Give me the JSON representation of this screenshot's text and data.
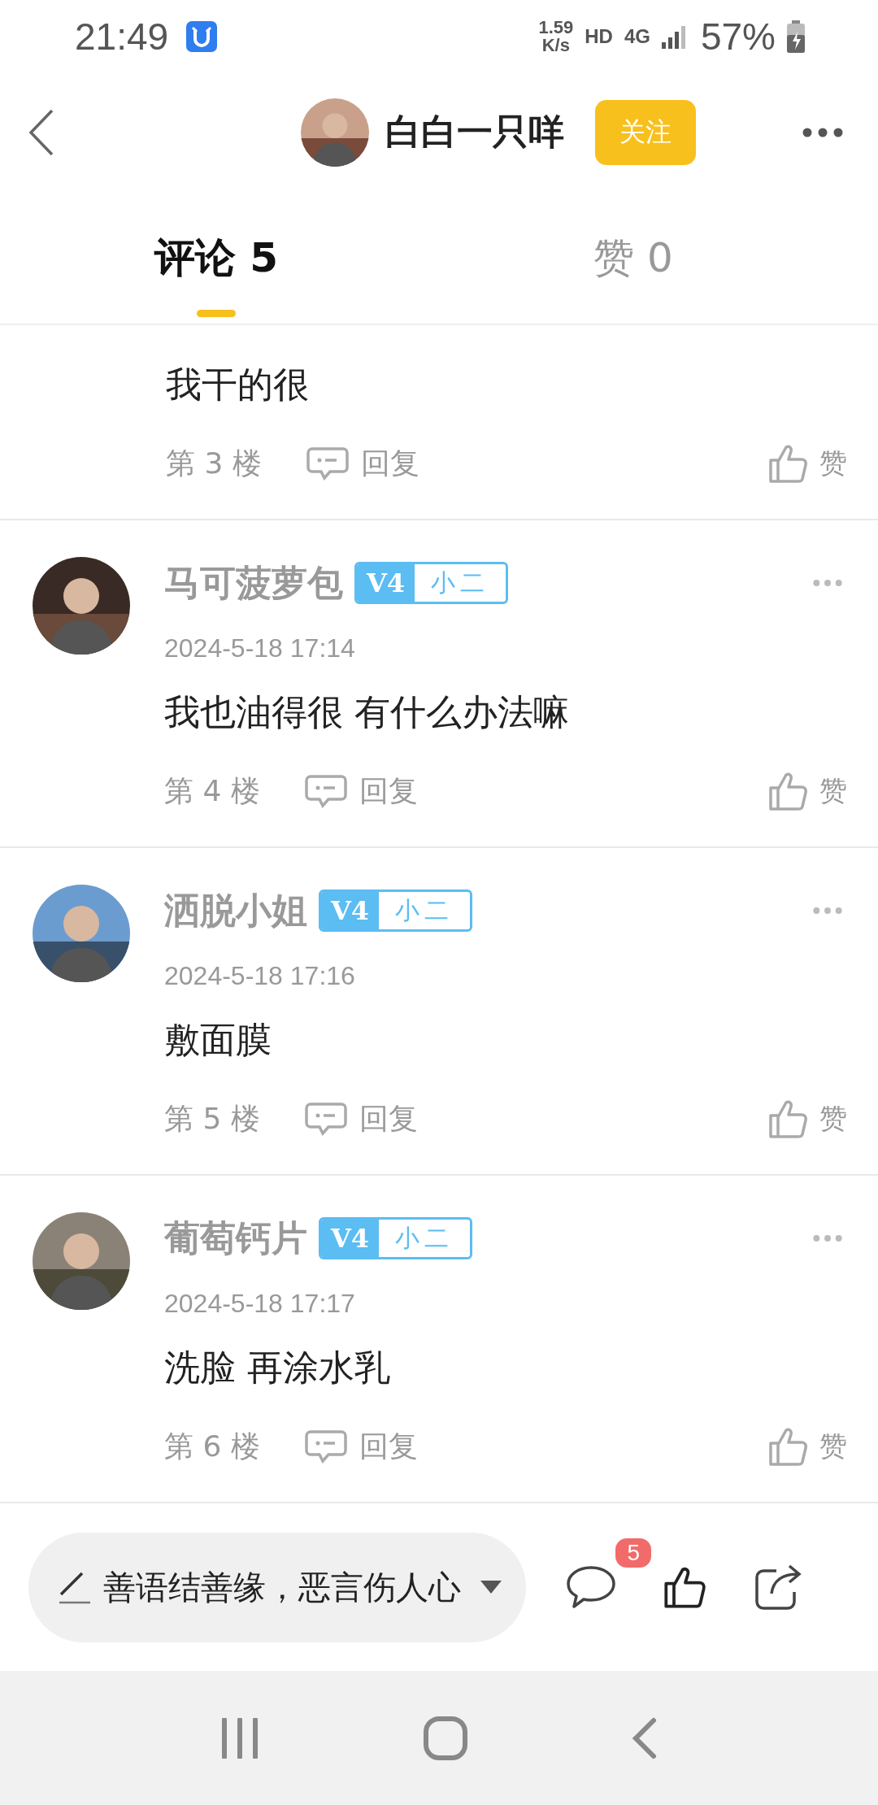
{
  "status_bar": {
    "time": "21:49",
    "net_speed": "1.59",
    "net_unit": "K/s",
    "hd": "HD",
    "network": "4G",
    "battery": "57%"
  },
  "header": {
    "title": "白白一只咩",
    "follow_button": "关注"
  },
  "tabs": [
    {
      "label": "评论 5",
      "selected": true
    },
    {
      "label": "赞 0",
      "selected": false
    }
  ],
  "partial_comment": {
    "content": "我干的很",
    "floor": "第 3 楼",
    "reply": "回复",
    "like": "赞"
  },
  "comments": [
    {
      "name": "马可菠萝包",
      "rank": "V4",
      "title": "小二",
      "date": "2024-5-18 17:14",
      "content": "我也油得很 有什么办法嘛",
      "floor": "第 4 楼",
      "reply": "回复",
      "like": "赞"
    },
    {
      "name": "洒脱小姐",
      "rank": "V4",
      "title": "小二",
      "date": "2024-5-18 17:16",
      "content": "敷面膜",
      "floor": "第 5 楼",
      "reply": "回复",
      "like": "赞"
    },
    {
      "name": "葡萄钙片",
      "rank": "V4",
      "title": "小二",
      "date": "2024-5-18 17:17",
      "content": "洗脸 再涂水乳",
      "floor": "第 6 楼",
      "reply": "回复",
      "like": "赞"
    }
  ],
  "comment_bar": {
    "placeholder": "善语结善缘，恶言伤人心",
    "comment_count": "5"
  }
}
